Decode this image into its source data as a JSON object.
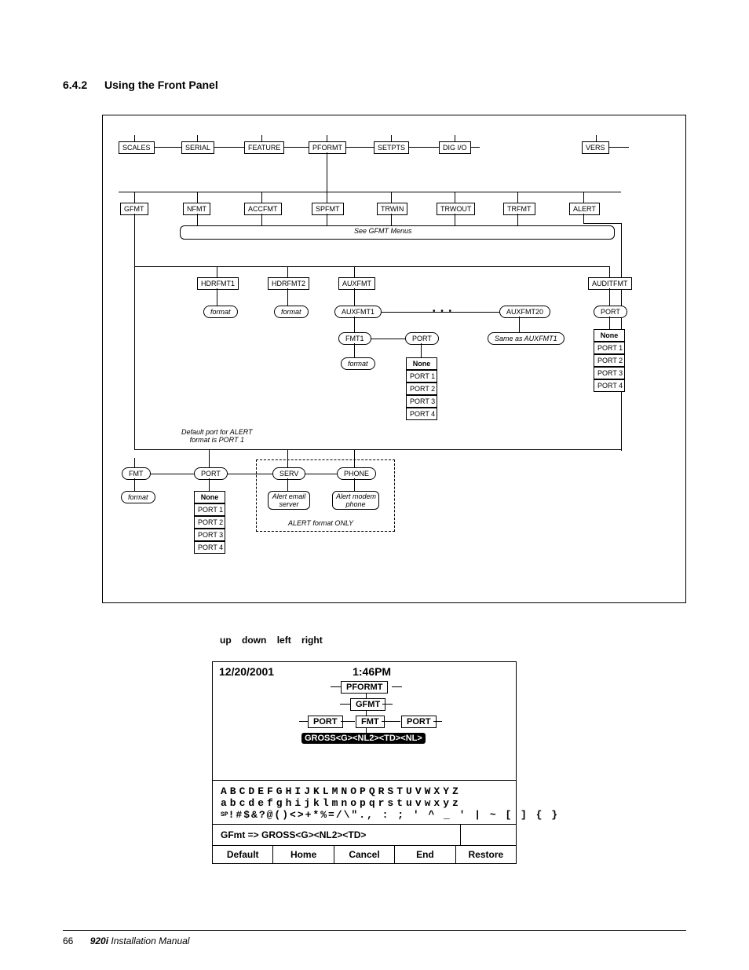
{
  "heading": {
    "num": "6.4.2",
    "title": "Using the Front Panel"
  },
  "diagram": {
    "row1": [
      "SCALES",
      "SERIAL",
      "FEATURE",
      "PFORMT",
      "SETPTS",
      "DIG I/O",
      "VERS"
    ],
    "row2": [
      "GFMT",
      "NFMT",
      "ACCFMT",
      "SPFMT",
      "TRWIN",
      "TRWOUT",
      "TRFMT",
      "ALERT"
    ],
    "gfmt_note": "See GFMT Menus",
    "row3": {
      "hdrfmt1": "HDRFMT1",
      "hdrfmt2": "HDRFMT2",
      "auxfmt": "AUXFMT",
      "auditfmt": "AUDITFMT"
    },
    "format_pill": "format",
    "aux": {
      "auxfmt1": "AUXFMT1",
      "auxfmt20": "AUXFMT20",
      "fmt1": "FMT1",
      "port": "PORT",
      "same_as": "Same as AUXFMT1",
      "port_list": [
        "None",
        "PORT 1",
        "PORT 2",
        "PORT 3",
        "PORT 4"
      ]
    },
    "audit": {
      "port": "PORT",
      "port_list": [
        "None",
        "PORT 1",
        "PORT 2",
        "PORT 3",
        "PORT 4"
      ]
    },
    "alert": {
      "note": "Default port for ALERT\nformat is PORT 1",
      "fmt": "FMT",
      "port": "PORT",
      "serv": "SERV",
      "phone": "PHONE",
      "serv_txt": "Alert email\nserver",
      "phone_txt": "Alert modem\nphone",
      "only_txt": "ALERT format ONLY",
      "port_list": [
        "None",
        "PORT 1",
        "PORT 2",
        "PORT 3",
        "PORT 4"
      ]
    }
  },
  "keywords": [
    "up",
    "down",
    "left",
    "right"
  ],
  "lcd": {
    "date": "12/20/2001",
    "time": "1:46PM",
    "tree": {
      "pformt": "PFORMT",
      "gfmt": "GFMT",
      "port_l": "PORT",
      "fmt": "FMT",
      "port_r": "PORT"
    },
    "inv": "GROSS<G><NL2><TD><NL>",
    "chars_row1": "ABCDEFGHIJKLMNOPQRSTUVWXYZ",
    "chars_row2": "abcdefghijklmnopqrstuvwxyz",
    "chars_row3_prefix": "SP",
    "chars_row3": "!#$&?@()<>+*%=/\\\"., : ; ' ^ _ ' | ~ [ ] { }",
    "template": "GFmt => GROSS<G><NL2><TD>",
    "softkeys": [
      "Default",
      "Home",
      "Cancel",
      "End",
      "Restore"
    ]
  },
  "footer": {
    "page": "66",
    "model": "920i",
    "manual": " Installation Manual"
  }
}
